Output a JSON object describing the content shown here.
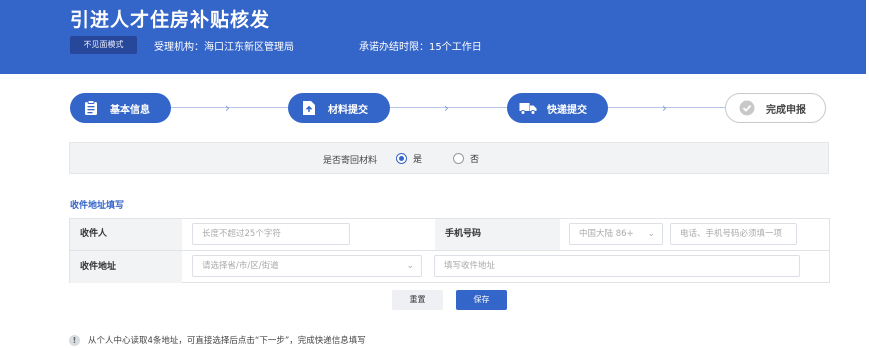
{
  "header": {
    "title": "引进人才住房补贴核发",
    "mode_button": "不见面模式",
    "agency": "受理机构：海口江东新区管理局",
    "deadline": "承诺办结时限：15个工作日"
  },
  "steps": [
    {
      "label": "基本信息",
      "icon": "clipboard-icon",
      "state": "active"
    },
    {
      "label": "材料提交",
      "icon": "upload-file-icon",
      "state": "active"
    },
    {
      "label": "快递提交",
      "icon": "truck-icon",
      "state": "active"
    },
    {
      "label": "完成申报",
      "icon": "check-circle-icon",
      "state": "inactive"
    }
  ],
  "return_materials": {
    "question": "是否寄回材料",
    "yes": "是",
    "no": "否",
    "selected": "是"
  },
  "address_section": {
    "title": "收件地址填写",
    "recipient_label": "收件人",
    "recipient_placeholder": "长度不超过25个字符",
    "phone_label": "手机号码",
    "country_code_value": "中国大陆 86+",
    "phone_placeholder": "电话、手机号码必须填一项",
    "address_label": "收件地址",
    "region_placeholder": "请选择省/市/区/街道",
    "detail_placeholder": "填写收件地址"
  },
  "actions": {
    "reset": "重置",
    "save": "保存"
  },
  "tip": {
    "icon": "!",
    "text": "从个人中心读取4条地址，可直接选择后点击“下一步”，完成快递信息填写"
  },
  "colors": {
    "primary": "#3465c9",
    "header_bg": "#3465c9",
    "mode_button_bg": "#27479a",
    "label_bg": "#f2f3f5"
  }
}
